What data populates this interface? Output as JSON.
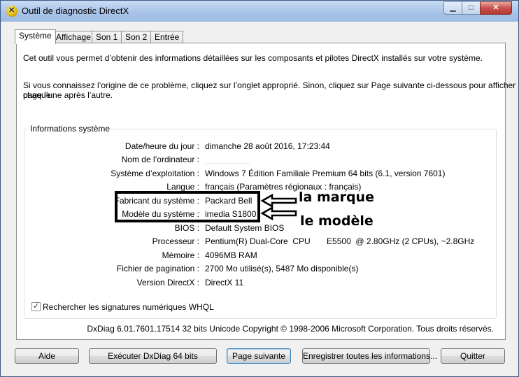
{
  "window": {
    "title": "Outil de diagnostic DirectX",
    "icon": "directx-icon",
    "controls": [
      "minimize",
      "maximize",
      "close"
    ]
  },
  "tabs": [
    {
      "label": "Système",
      "active": true
    },
    {
      "label": "Affichage",
      "active": false
    },
    {
      "label": "Son 1",
      "active": false
    },
    {
      "label": "Son 2",
      "active": false
    },
    {
      "label": "Entrée",
      "active": false
    }
  ],
  "intro": {
    "para1": "Cet outil vous permet d’obtenir des informations détaillées sur les composants et pilotes DirectX installés sur votre système.",
    "para2_line1": "Si vous connaissez l’origine de ce problème, cliquez sur l’onglet approprié. Sinon, cliquez sur Page suivante ci-dessous pour afficher chaque",
    "para2_line2": "page l’une après l’autre."
  },
  "system_info": {
    "group_title": "Informations système",
    "rows": [
      {
        "label": "Date/heure du jour :",
        "value": "dimanche 28 août 2016, 17:23:44"
      },
      {
        "label": "Nom de l’ordinateur :",
        "value": ""
      },
      {
        "label": "Système d’exploitation :",
        "value": "Windows 7 Édition Familiale Premium 64 bits (6.1, version 7601)"
      },
      {
        "label": "Langue :",
        "value": "français (Paramètres régionaux : français)"
      },
      {
        "label": "Fabricant du système :",
        "value": "Packard Bell"
      },
      {
        "label": "Modèle du système :",
        "value": "imedia S1800"
      },
      {
        "label": "BIOS :",
        "value": "Default System BIOS"
      },
      {
        "label": "Processeur :",
        "value": "Pentium(R) Dual-Core  CPU       E5500  @ 2.80GHz (2 CPUs), ~2.8GHz"
      },
      {
        "label": "Mémoire :",
        "value": "4096MB RAM"
      },
      {
        "label": "Fichier de pagination :",
        "value": "2700 Mo utilisé(s), 5487 Mo disponible(s)"
      },
      {
        "label": "Version DirectX :",
        "value": "DirectX 11"
      }
    ]
  },
  "annotations": {
    "brand": "la marque",
    "model": "le modèle"
  },
  "whql_checkbox": {
    "label": "Rechercher les signatures numériques WHQL",
    "checked": true
  },
  "footer_text": "DxDiag 6.01.7601.17514 32 bits Unicode Copyright © 1998-2006 Microsoft Corporation. Tous droits réservés.",
  "buttons": {
    "help": "Aide",
    "run64": "Exécuter DxDiag 64 bits",
    "next": "Page suivante",
    "save": "Enregistrer toutes les informations...",
    "quit": "Quitter"
  }
}
